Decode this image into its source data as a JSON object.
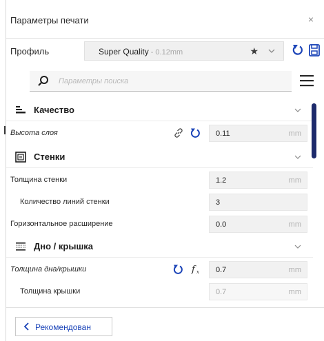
{
  "window": {
    "title": "Параметры печати",
    "close_glyph": "×"
  },
  "profile": {
    "label": "Профиль",
    "name": "Super Quality",
    "detail": "- 0.12mm",
    "star_glyph": "★"
  },
  "search": {
    "placeholder": "Параметры поиска"
  },
  "categories": {
    "quality": {
      "title": "Качество"
    },
    "walls": {
      "title": "Стенки"
    },
    "topbottom": {
      "title": "Дно / крышка"
    }
  },
  "settings": {
    "layer_height": {
      "label": "Высота слоя",
      "value": "0.11",
      "unit": "mm"
    },
    "wall_thickness": {
      "label": "Толщина стенки",
      "value": "1.2",
      "unit": "mm"
    },
    "wall_line_count": {
      "label": "Количество линий стенки",
      "value": "3"
    },
    "horizontal_expansion": {
      "label": "Горизонтальное расширение",
      "value": "0.0",
      "unit": "mm"
    },
    "top_bottom_thickness": {
      "label": "Толщина дна/крышки",
      "value": "0.7",
      "unit": "mm"
    },
    "top_thickness": {
      "label": "Толщина крышки",
      "value": "0.7",
      "unit": "mm"
    }
  },
  "footer": {
    "recommended_label": "Рекомендован"
  },
  "colors": {
    "accent_blue": "#1b44b8",
    "scrollbar": "#1d2a6b",
    "field_bg": "#f1f1f1"
  }
}
